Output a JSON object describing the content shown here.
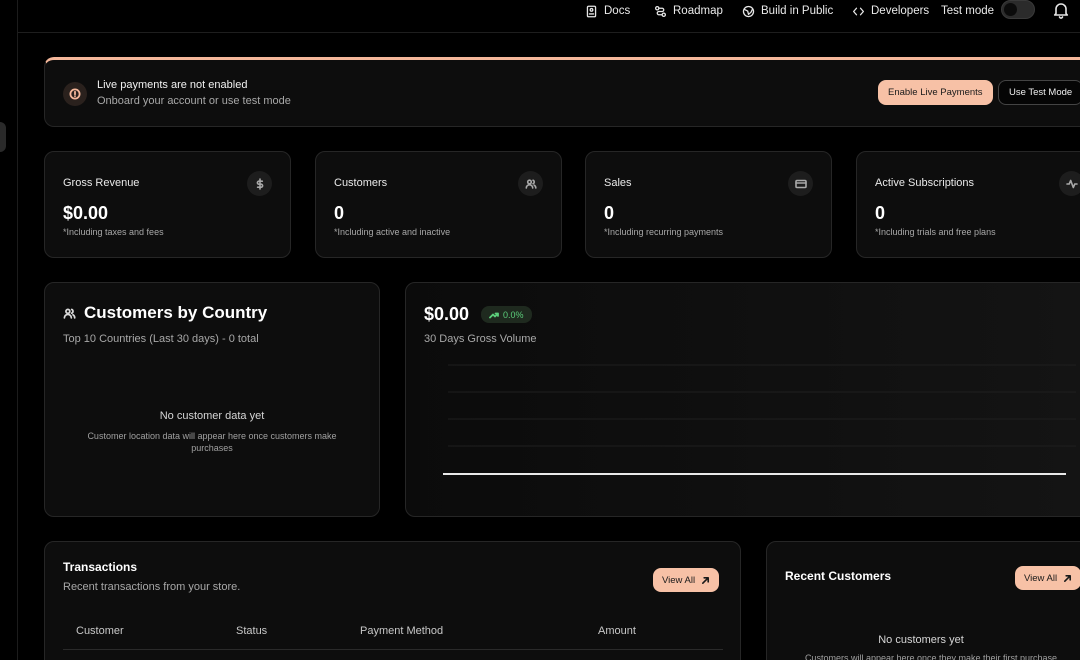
{
  "topbar": {
    "docs": "Docs",
    "roadmap": "Roadmap",
    "build_in_public": "Build in Public",
    "developers": "Developers",
    "test_mode": "Test mode"
  },
  "banner": {
    "title": "Live payments are not enabled",
    "subtitle": "Onboard your account or use test mode",
    "enable_button": "Enable Live Payments",
    "test_button": "Use Test Mode"
  },
  "stats": [
    {
      "label": "Gross Revenue",
      "value": "$0.00",
      "note": "*Including taxes and fees",
      "icon": "dollar-icon"
    },
    {
      "label": "Customers",
      "value": "0",
      "note": "*Including active and inactive",
      "icon": "users-icon"
    },
    {
      "label": "Sales",
      "value": "0",
      "note": "*Including recurring payments",
      "icon": "credit-card-icon"
    },
    {
      "label": "Active Subscriptions",
      "value": "0",
      "note": "*Including trials and free plans",
      "icon": "activity-icon"
    }
  ],
  "country": {
    "title": "Customers by Country",
    "subtitle": "Top 10 Countries (Last 30 days) - 0 total",
    "empty_title": "No customer data yet",
    "empty_subtitle": "Customer location data will appear here once customers make purchases"
  },
  "volume": {
    "value": "$0.00",
    "change": "0.0%",
    "subtitle": "30 Days Gross Volume"
  },
  "transactions": {
    "title": "Transactions",
    "subtitle": "Recent transactions from your store.",
    "view_all": "View All",
    "columns": [
      "Customer",
      "Status",
      "Payment Method",
      "Amount"
    ]
  },
  "recent_customers": {
    "title": "Recent Customers",
    "view_all": "View All",
    "empty_title": "No customers yet",
    "empty_subtitle": "Customers will appear here once they make their first purchase"
  },
  "colors": {
    "accent": "#f7c1a6",
    "positive": "#5ccf7b"
  }
}
